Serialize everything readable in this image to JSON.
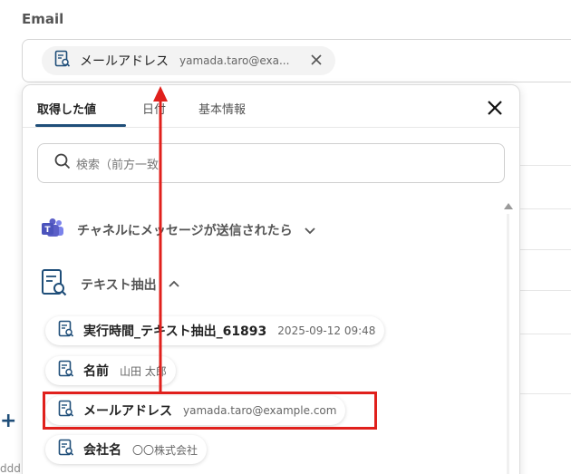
{
  "field": {
    "label": "Email"
  },
  "input_chip": {
    "label": "メールアドレス",
    "value": "yamada.taro@exa...",
    "remove_icon": "close-icon"
  },
  "tabs": [
    {
      "label": "取得した値",
      "active": true
    },
    {
      "label": "日付",
      "active": false
    },
    {
      "label": "基本情報",
      "active": false
    }
  ],
  "search": {
    "placeholder": "検索（前方一致"
  },
  "groups": [
    {
      "title": "チャネルにメッセージが送信されたら",
      "icon": "teams-icon",
      "expanded": false
    },
    {
      "title": "テキスト抽出",
      "icon": "document-search-icon",
      "expanded": true
    }
  ],
  "items": [
    {
      "label": "実行時間_テキスト抽出_61893",
      "value": "2025-09-12 09:48"
    },
    {
      "label": "名前",
      "value": "山田 太郎"
    },
    {
      "label": "メールアドレス",
      "value": "yamada.taro@example.com",
      "highlighted": true
    },
    {
      "label": "会社名",
      "value": "〇〇株式会社"
    }
  ],
  "colors": {
    "accent": "#1f4e79",
    "highlight": "#e0201c",
    "teams": "#5b5fc7"
  }
}
